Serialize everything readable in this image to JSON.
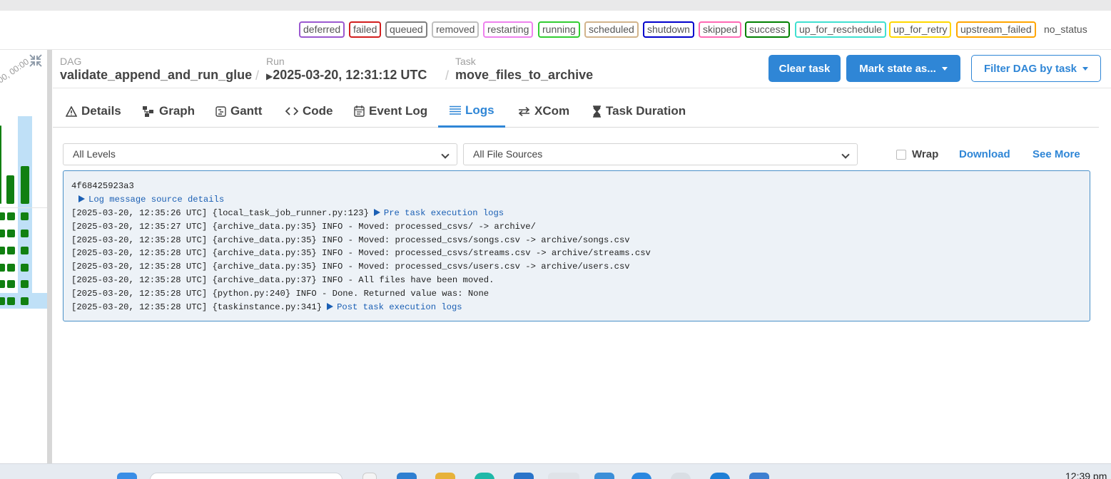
{
  "legend": [
    {
      "label": "deferred",
      "color": "#9b59d0"
    },
    {
      "label": "failed",
      "color": "#d21f1f"
    },
    {
      "label": "queued",
      "color": "#808080"
    },
    {
      "label": "removed",
      "color": "#bfbfbf"
    },
    {
      "label": "restarting",
      "color": "#ee82ee"
    },
    {
      "label": "running",
      "color": "#32cd32"
    },
    {
      "label": "scheduled",
      "color": "#d2b48c"
    },
    {
      "label": "shutdown",
      "color": "#0000cc"
    },
    {
      "label": "skipped",
      "color": "#ff69b4"
    },
    {
      "label": "success",
      "color": "#008000"
    },
    {
      "label": "up_for_reschedule",
      "color": "#40e0d0"
    },
    {
      "label": "up_for_retry",
      "color": "#ffd700"
    },
    {
      "label": "upstream_failed",
      "color": "#ffa500"
    },
    {
      "label": "no_status",
      "color": ""
    }
  ],
  "grid": {
    "axis_label": "00, 00:00"
  },
  "header": {
    "dag_label": "DAG",
    "dag_value": "validate_append_and_run_glue",
    "run_label": "Run",
    "run_value": "2025-03-20, 12:31:12 UTC",
    "task_label": "Task",
    "task_value": "move_files_to_archive",
    "separator": "/"
  },
  "actions": {
    "clear_task": "Clear task",
    "mark_state": "Mark state as...",
    "filter_dag": "Filter DAG by task"
  },
  "tabs": [
    {
      "label": "Details",
      "icon": "warning-triangle-icon"
    },
    {
      "label": "Graph",
      "icon": "graph-icon"
    },
    {
      "label": "Gantt",
      "icon": "gantt-icon"
    },
    {
      "label": "Code",
      "icon": "code-icon"
    },
    {
      "label": "Event Log",
      "icon": "calendar-icon"
    },
    {
      "label": "Logs",
      "icon": "list-icon",
      "active": true
    },
    {
      "label": "XCom",
      "icon": "exchange-icon"
    },
    {
      "label": "Task Duration",
      "icon": "hourglass-icon"
    }
  ],
  "filters": {
    "levels": "All Levels",
    "sources": "All File Sources",
    "wrap": "Wrap",
    "download": "Download",
    "see_more": "See More"
  },
  "log": {
    "host": "4f68425923a3",
    "source_details": "Log message source details",
    "pre_prefix": "[2025-03-20, 12:35:26 UTC] {local_task_job_runner.py:123}",
    "pre_link": "Pre task execution logs",
    "lines": [
      "[2025-03-20, 12:35:27 UTC] {archive_data.py:35} INFO - Moved: processed_csvs/ -> archive/",
      "[2025-03-20, 12:35:28 UTC] {archive_data.py:35} INFO - Moved: processed_csvs/songs.csv -> archive/songs.csv",
      "[2025-03-20, 12:35:28 UTC] {archive_data.py:35} INFO - Moved: processed_csvs/streams.csv -> archive/streams.csv",
      "[2025-03-20, 12:35:28 UTC] {archive_data.py:35} INFO - Moved: processed_csvs/users.csv -> archive/users.csv",
      "[2025-03-20, 12:35:28 UTC] {archive_data.py:37} INFO - All files have been moved.",
      "[2025-03-20, 12:35:28 UTC] {python.py:240} INFO - Done. Returned value was: None"
    ],
    "post_prefix": "[2025-03-20, 12:35:28 UTC] {taskinstance.py:341}",
    "post_link": "Post task execution logs"
  },
  "taskbar": {
    "clock": "12:39 pm"
  }
}
